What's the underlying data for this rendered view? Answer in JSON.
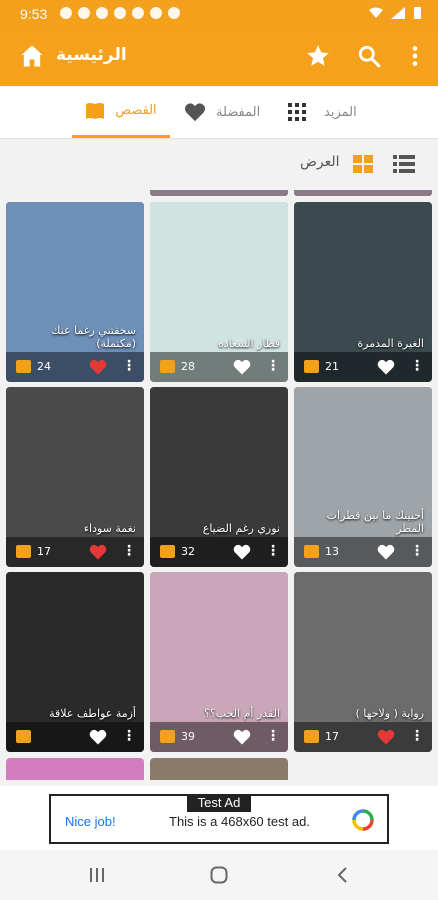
{
  "status_bar": {
    "time": "9:53"
  },
  "app_bar": {
    "title": "الرئيسية",
    "icons": [
      "home-icon",
      "star-icon",
      "search-icon",
      "more-vert-icon"
    ]
  },
  "tabs": [
    {
      "label": "القصص",
      "icon": "book-icon",
      "active": true
    },
    {
      "label": "المفضلة",
      "icon": "heart-icon",
      "active": false
    },
    {
      "label": "المزيد",
      "icon": "grid-dots-icon",
      "active": false
    }
  ],
  "view": {
    "label": "العرض",
    "icons": [
      "grid-view-icon",
      "list-view-icon"
    ]
  },
  "colors": {
    "accent": "#f3a01c",
    "heart_active": "#e53935",
    "heart_inactive": "#ffffff"
  },
  "stories": [
    {
      "title": "سحقتني رغما عنك (مكتملة)",
      "parts": "24",
      "favorited": true,
      "cover_color": "#6d8fb8"
    },
    {
      "title": "قطار السعاده",
      "parts": "28",
      "favorited": false,
      "cover_color": "#cfe3e0"
    },
    {
      "title": "الغيرة المدمرة",
      "parts": "21",
      "favorited": false,
      "cover_color": "#3b4a4f"
    },
    {
      "title": "نغمة سوداء",
      "parts": "17",
      "favorited": true,
      "cover_color": "#4a4a4a"
    },
    {
      "title": "نوري رغم الضياع",
      "parts": "32",
      "favorited": false,
      "cover_color": "#3a3a3a"
    },
    {
      "title": "أحبيتك ما بين قطرات المطر",
      "parts": "13",
      "favorited": false,
      "cover_color": "#9fa4a8"
    },
    {
      "title": "أزمة عواطف علاقة",
      "parts": "",
      "favorited": false,
      "cover_color": "#2a2a2a"
    },
    {
      "title": "القدر أم الحب؟؟",
      "parts": "39",
      "favorited": false,
      "cover_color": "#c9a7b8"
    },
    {
      "title": "( رواية ( ولاحها",
      "parts": "17",
      "favorited": true,
      "cover_color": "#6c6c6c"
    }
  ],
  "ad": {
    "label": "Test Ad",
    "nice_job": "Nice job!",
    "text": "This is a 468x60 test ad."
  }
}
